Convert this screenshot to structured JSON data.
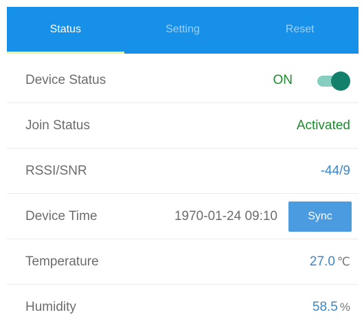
{
  "tabs": [
    {
      "label": "Status",
      "active": true
    },
    {
      "label": "Setting",
      "active": false
    },
    {
      "label": "Reset",
      "active": false
    }
  ],
  "rows": {
    "device_status": {
      "label": "Device Status",
      "value": "ON",
      "toggle_on": true
    },
    "join_status": {
      "label": "Join Status",
      "value": "Activated"
    },
    "rssi_snr": {
      "label": "RSSI/SNR",
      "value": "-44/9"
    },
    "device_time": {
      "label": "Device Time",
      "value": "1970-01-24 09:10",
      "button_label": "Sync"
    },
    "temperature": {
      "label": "Temperature",
      "value": "27.0",
      "unit": "℃"
    },
    "humidity": {
      "label": "Humidity",
      "value": "58.5",
      "unit": "%"
    }
  },
  "colors": {
    "tab_bar": "#1690e8",
    "tab_indicator": "#f2f58a",
    "status_green": "#1a8c2c",
    "value_blue": "#3a86c8",
    "toggle_knob": "#13806b",
    "toggle_track": "#86cfc0",
    "sync_button": "#4a9be0"
  }
}
